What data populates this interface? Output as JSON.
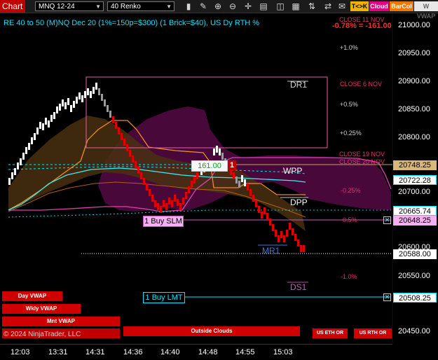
{
  "toolbar": {
    "chart_label": "Chart",
    "instrument": "MNQ 12-24",
    "period": "40 Renko",
    "tk_label": "T<>K",
    "cloud_label": "Cloud",
    "barcol_label": "BarCol",
    "vwap_label": "W VWAP"
  },
  "chart_title": "RE 40 to 50 (M)NQ Dec 20 (1%=150p=$300) (1 Brick=$40), US Dy RTH %",
  "change_label": "-0.78% = -161.00",
  "pct_labels": {
    "p1_0": "+1.0%",
    "p0_5": "+0.5%",
    "p0_25": "+0.25%",
    "m0_25": "-0.25%",
    "m0_5": "-0.5%",
    "m1_0": "-1.0%"
  },
  "close_labels": {
    "c11": "CLOSE 11 NOV",
    "c6": "CLOSE 6 NOV",
    "c19": "CLOSE 19 NOV",
    "c20": "CLOSE 20 NOV"
  },
  "levels": {
    "dr1": "DR1",
    "wpp": "WPP",
    "dpp": "DPP",
    "mr1": "MR1",
    "ds1": "DS1"
  },
  "orders": {
    "profit": "161.00",
    "qty": "1",
    "buy_slm": "1 Buy SLM",
    "buy_lmt": "1 Buy LMT"
  },
  "y_axis": [
    "21000.00",
    "20950.00",
    "20900.00",
    "20850.00",
    "20800.00",
    "20700.00",
    "20600.00",
    "20550.00",
    "20450.00"
  ],
  "price_boxes": {
    "p1": "20748.25",
    "p2": "20722.28",
    "p3": "20665.74",
    "p4": "20648.25",
    "p5": "20588.00",
    "p6": "20508.25"
  },
  "x_axis": [
    "12:03",
    "13:31",
    "14:31",
    "14:36",
    "14:40",
    "14:48",
    "14:55",
    "15:03"
  ],
  "indicator_labels": {
    "day_vwap": "Day VWAP",
    "wkly_vwap": "Wkly VWAP",
    "mnt_vwap": "Mnt VWAP",
    "outside_clouds": "Outside Clouds",
    "us_eth": "US ETH OR",
    "us_rth": "US RTH OR"
  },
  "copyright": "© 2024 NinjaTrader, LLC",
  "colors": {
    "cyan": "#00e5ff",
    "red": "#e00000",
    "pink": "#e060c0",
    "orange": "#f08c1c"
  }
}
